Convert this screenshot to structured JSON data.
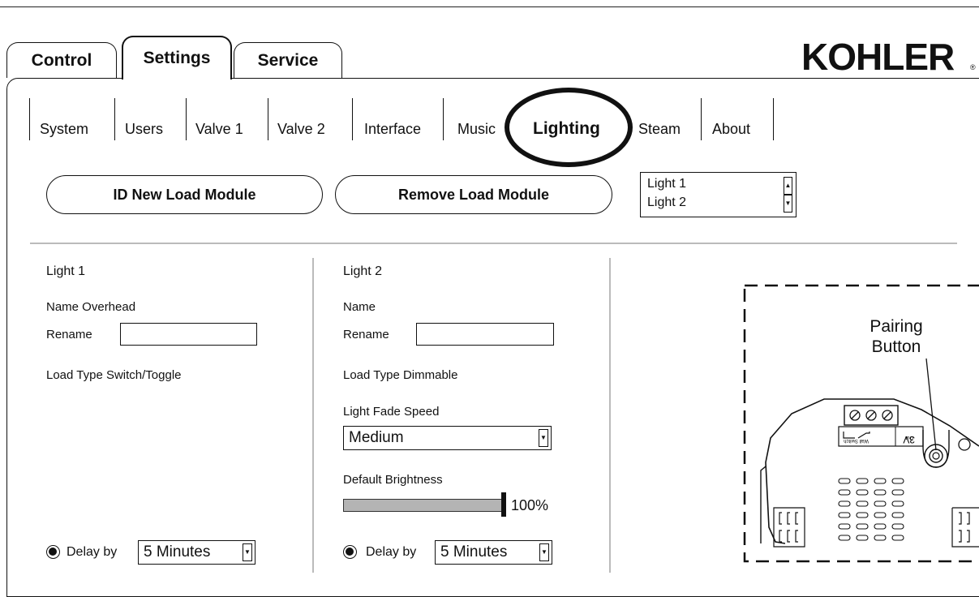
{
  "main_tabs": [
    {
      "label": "Control"
    },
    {
      "label": "Settings"
    },
    {
      "label": "Service"
    }
  ],
  "brand": {
    "logo": "KOHLER",
    "registered": "®"
  },
  "sub_tabs": [
    {
      "label": "System"
    },
    {
      "label": "Users"
    },
    {
      "label": "Valve 1"
    },
    {
      "label": "Valve 2"
    },
    {
      "label": "Interface"
    },
    {
      "label": "Music"
    },
    {
      "label": "Lighting"
    },
    {
      "label": "Steam"
    },
    {
      "label": "About"
    }
  ],
  "actions": {
    "id_new": "ID New Load Module",
    "remove": "Remove Load Module"
  },
  "light_list": [
    "Light 1",
    "Light 2"
  ],
  "light1": {
    "title": "Light 1",
    "name_label": "Name Overhead",
    "rename_label": "Rename",
    "rename_value": "",
    "load_type": "Load Type Switch/Toggle",
    "delay_label": "Delay by",
    "delay_value": "5 Minutes"
  },
  "light2": {
    "title": "Light 2",
    "name_label": "Name",
    "rename_label": "Rename",
    "rename_value": "",
    "load_type": "Load Type Dimmable",
    "fade_label": "Light Fade Speed",
    "fade_value": "Medium",
    "brightness_label": "Default Brightness",
    "brightness_value": "100%",
    "brightness_level": 1.0,
    "delay_label": "Delay by",
    "delay_value": "5 Minutes"
  },
  "diagram": {
    "callout": [
      "Pairing",
      "Button"
    ],
    "terminal_labels": [
      "Out",
      "Wall Switch",
      "3V"
    ]
  }
}
